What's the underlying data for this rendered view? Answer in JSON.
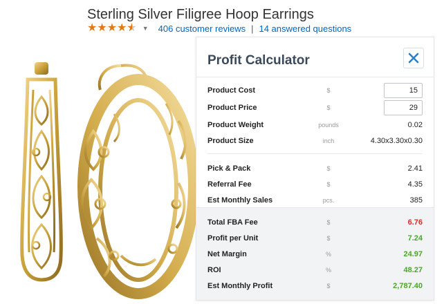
{
  "product": {
    "title": "Sterling Silver Filigree Hoop Earrings",
    "rating": 4.5,
    "reviews_link": "406 customer reviews",
    "separator": "|",
    "questions_link": "14 answered questions"
  },
  "colors": {
    "star": "#e47911",
    "link": "#0066c0",
    "panel_title": "#3b4a5a",
    "close_icon": "#2a7fc9",
    "negative": "#d0312d",
    "positive": "#4aa827",
    "gold": "#c9a13a"
  },
  "calculator": {
    "title": "Profit Calculator",
    "close_icon": "close-x-icon",
    "inputs": [
      {
        "label": "Product Cost",
        "unit": "$",
        "value": "15"
      },
      {
        "label": "Product Price",
        "unit": "$",
        "value": "29"
      }
    ],
    "specs": [
      {
        "label": "Product Weight",
        "unit": "pounds",
        "value": "0.02"
      },
      {
        "label": "Product Size",
        "unit": "inch",
        "value": "4.30x3.30x0.30"
      }
    ],
    "fees": [
      {
        "label": "Pick & Pack",
        "unit": "$",
        "value": "2.41"
      },
      {
        "label": "Referral Fee",
        "unit": "$",
        "value": "4.35"
      },
      {
        "label": "Est Monthly Sales",
        "unit": "pcs.",
        "value": "385"
      }
    ],
    "results": [
      {
        "label": "Total FBA Fee",
        "unit": "$",
        "value": "6.76",
        "tone": "red"
      },
      {
        "label": "Profit per Unit",
        "unit": "$",
        "value": "7.24",
        "tone": "green"
      },
      {
        "label": "Net Margin",
        "unit": "%",
        "value": "24.97",
        "tone": "green"
      },
      {
        "label": "ROI",
        "unit": "%",
        "value": "48.27",
        "tone": "green"
      },
      {
        "label": "Est Monthly Profit",
        "unit": "$",
        "value": "2,787.40",
        "tone": "green"
      }
    ]
  }
}
